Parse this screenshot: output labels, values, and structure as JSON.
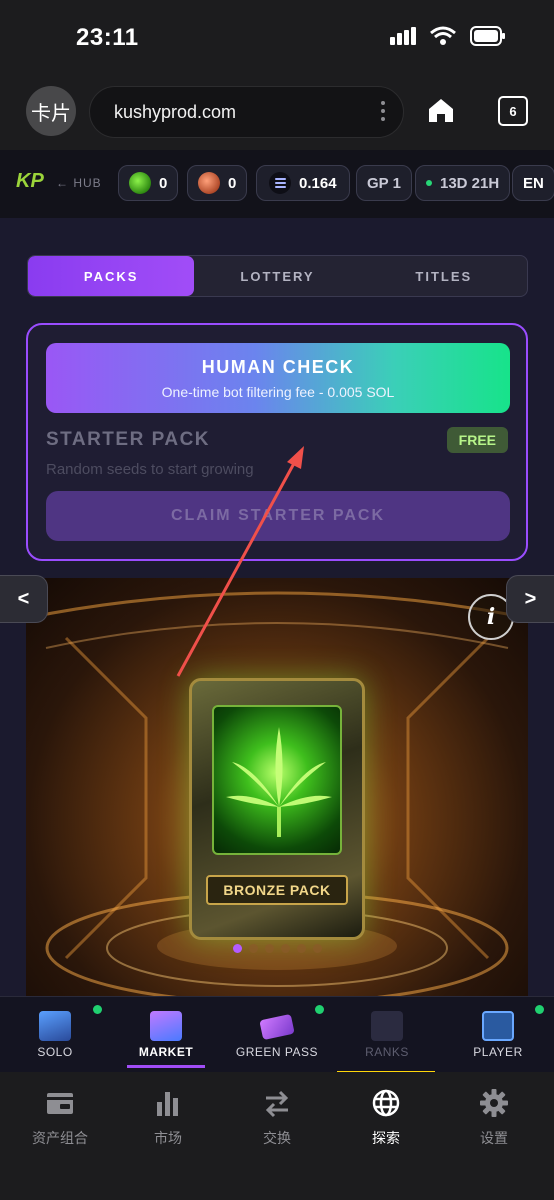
{
  "status_bar": {
    "time": "23:11"
  },
  "browser": {
    "tab_label": "卡片",
    "url": "kushyprod.com",
    "tab_count": "6"
  },
  "header": {
    "logo": "KP",
    "hub_link": "← HUB",
    "green_seeds": "0",
    "red_seeds": "0",
    "sol_balance": "0.164",
    "gp_level": "GP 1",
    "season_timer": "13D 21H",
    "language": "EN"
  },
  "tabs": [
    "PACKS",
    "LOTTERY",
    "TITLES"
  ],
  "starter": {
    "human_check_title": "HUMAN CHECK",
    "human_check_subtitle": "One-time bot filtering fee - 0.005 SOL",
    "title": "STARTER PACK",
    "badge": "FREE",
    "subtitle": "Random seeds to start growing",
    "claim_label": "CLAIM STARTER PACK"
  },
  "carousel": {
    "pack_label": "BRONZE PACK",
    "info_label": "i",
    "prev_label": "<",
    "next_label": ">",
    "active_index": 0,
    "count": 6
  },
  "app_nav": [
    "SOLO",
    "MARKET",
    "GREEN PASS",
    "RANKS",
    "PLAYER"
  ],
  "wallet_nav": [
    "资产组合",
    "市场",
    "交换",
    "探索",
    "设置"
  ],
  "colors": {
    "accent_purple": "#a14df7",
    "accent_green": "#17e38a",
    "notify_dot": "#20d070",
    "highlight_yellow": "#ffd60a"
  }
}
